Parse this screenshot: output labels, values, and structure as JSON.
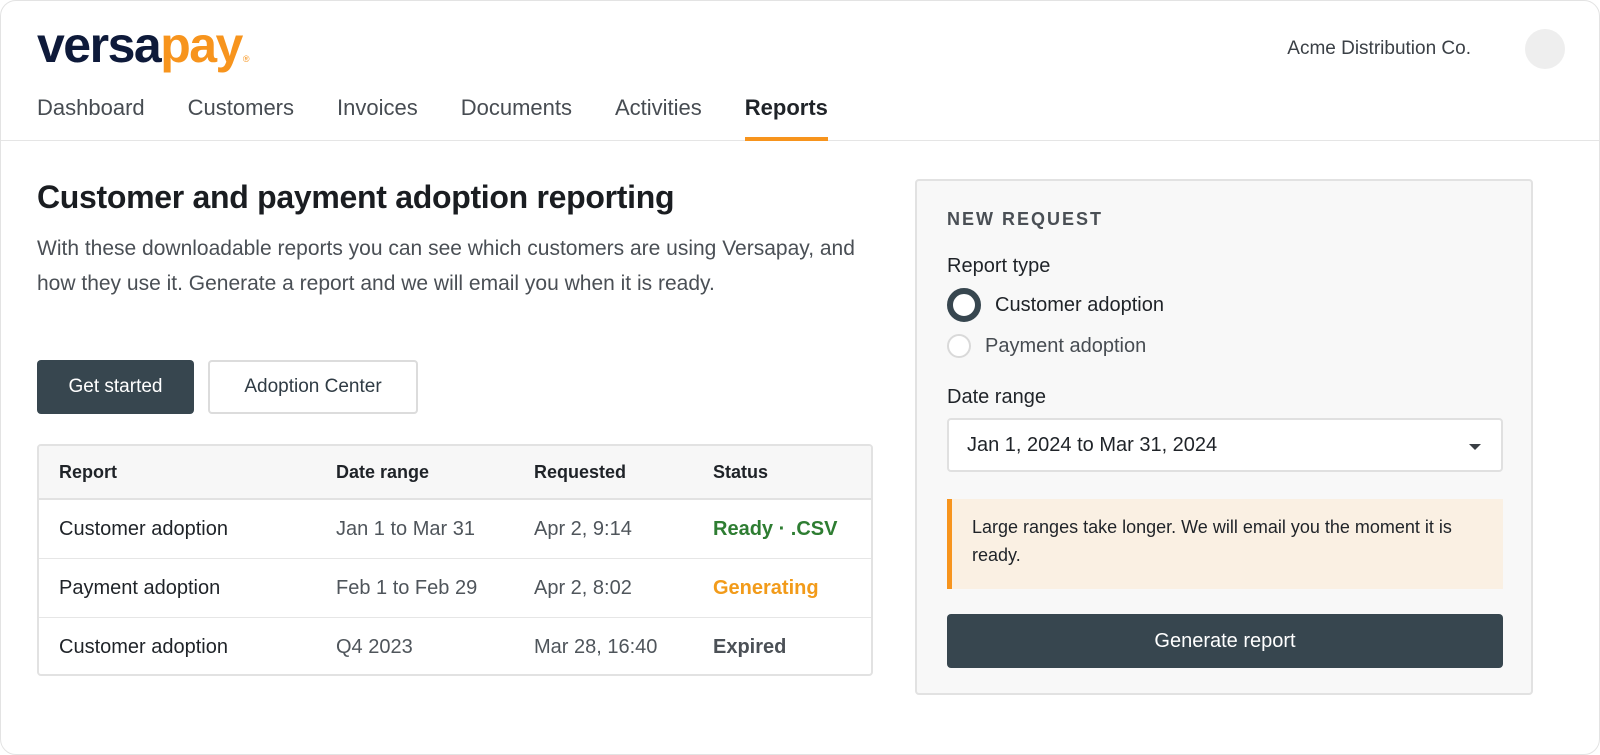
{
  "brand": {
    "logo_part1": "versa",
    "logo_part2": "pay",
    "logo_mark": "®",
    "accent_color": "#f7941d",
    "dark_color": "#37464f"
  },
  "header": {
    "organization": "Acme Distribution Co.",
    "avatar_icon": "user-avatar"
  },
  "nav": {
    "items": [
      {
        "label": "Dashboard"
      },
      {
        "label": "Customers"
      },
      {
        "label": "Invoices"
      },
      {
        "label": "Documents"
      },
      {
        "label": "Activities"
      },
      {
        "label": "Reports"
      }
    ],
    "active": "Reports"
  },
  "main": {
    "title": "Customer and payment adoption reporting",
    "intro": "With these downloadable reports you can see which customers are using Versapay, and how they use it. Generate a report and we will email you when it is ready.",
    "primary_button": "Get started",
    "secondary_button": "Adoption Center"
  },
  "table": {
    "headers": [
      "Report",
      "Date range",
      "Requested",
      "Status"
    ],
    "rows": [
      {
        "report": "Customer adoption",
        "date_range": "Jan 1 to Mar 31",
        "requested": "Apr 2, 9:14",
        "status": "Ready · .CSV",
        "status_color": "#2e7d32"
      },
      {
        "report": "Payment adoption",
        "date_range": "Feb 1 to Feb 29",
        "requested": "Apr 2, 8:02",
        "status": "Generating",
        "status_color": "#f29b1a"
      },
      {
        "report": "Customer adoption",
        "date_range": "Q4 2023",
        "requested": "Mar 28, 16:40",
        "status": "Expired",
        "status_color": "#4b5056"
      }
    ]
  },
  "panel": {
    "heading": "NEW REQUEST",
    "report_type_label": "Report type",
    "options": [
      {
        "label": "Customer adoption",
        "selected": true
      },
      {
        "label": "Payment adoption",
        "selected": false
      }
    ],
    "date_range_label": "Date range",
    "date_range_value": "Jan 1, 2024 to Mar 31, 2024",
    "notice": "Large ranges take longer. We will email you the moment it is ready.",
    "generate_button": "Generate report"
  }
}
